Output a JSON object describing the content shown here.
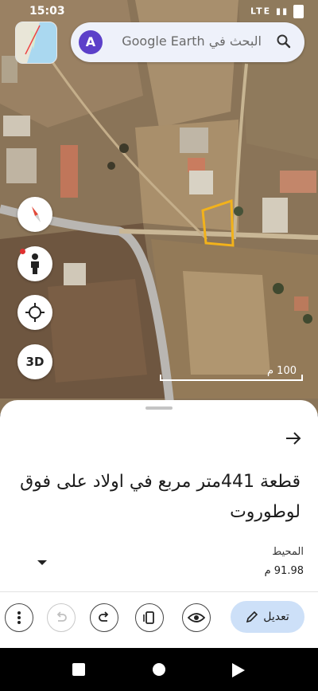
{
  "status_bar": {
    "time": "15:03",
    "network": "LTE"
  },
  "search": {
    "avatar_letter": "A",
    "placeholder": "البحث في Google Earth"
  },
  "map_controls": {
    "three_d_label": "3D",
    "scale_label": "100 م"
  },
  "sheet": {
    "title": "قطعة 441متر مربع في اولاد على فوق لوطوروت",
    "perimeter_label": "المحيط",
    "perimeter_value": "91.98 م"
  },
  "toolbar": {
    "edit_label": "تعديل"
  },
  "colors": {
    "polygon": "#f2b21b",
    "edit_button": "#cde0f8",
    "avatar": "#5c40c9",
    "compass_needle": "#e24a3a"
  },
  "icons": [
    "more-vert-icon",
    "undo-icon",
    "redo-icon",
    "device-icon",
    "eye-icon",
    "pencil-icon",
    "compass-icon",
    "pegman-icon",
    "crosshair-icon",
    "search-icon",
    "arrow-right-icon",
    "chevron-down-icon"
  ]
}
